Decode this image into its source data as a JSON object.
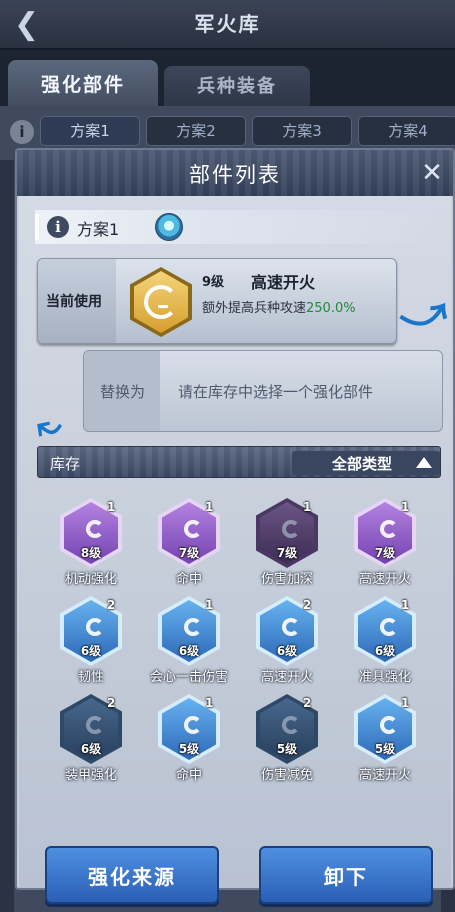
{
  "header": {
    "back_icon": "back-chevron-icon",
    "title": "军火库"
  },
  "tabs": [
    {
      "label": "强化部件",
      "active": true
    },
    {
      "label": "兵种装备",
      "active": false
    }
  ],
  "plans": {
    "info_icon": "i",
    "items": [
      {
        "label": "方案1",
        "active": true
      },
      {
        "label": "方案2",
        "active": false
      },
      {
        "label": "方案3",
        "active": false
      },
      {
        "label": "方案4",
        "active": false
      }
    ]
  },
  "modal": {
    "title": "部件列表",
    "close_icon": "✕",
    "plan": {
      "info_icon": "i",
      "name": "方案1"
    },
    "current": {
      "label": "当前使用",
      "level": "9级",
      "name": "高速开火",
      "desc_prefix": "额外提高兵种攻速",
      "desc_value": "250.0%"
    },
    "replace": {
      "label": "替换为",
      "hint": "请在库存中选择一个强化部件"
    },
    "inventory": {
      "label": "库存",
      "filter": "全部类型"
    },
    "items": [
      {
        "level": "8级",
        "count": "1",
        "name": "机动强化",
        "color": "purple"
      },
      {
        "level": "7级",
        "count": "1",
        "name": "命中",
        "color": "purple"
      },
      {
        "level": "7级",
        "count": "1",
        "name": "伤害加深",
        "color": "dark-purple"
      },
      {
        "level": "7级",
        "count": "1",
        "name": "高速开火",
        "color": "purple"
      },
      {
        "level": "6级",
        "count": "2",
        "name": "韧性",
        "color": "blue"
      },
      {
        "level": "6级",
        "count": "1",
        "name": "会心一击伤害",
        "color": "blue"
      },
      {
        "level": "6级",
        "count": "2",
        "name": "高速开火",
        "color": "blue"
      },
      {
        "level": "6级",
        "count": "1",
        "name": "准具强化",
        "color": "blue"
      },
      {
        "level": "6级",
        "count": "2",
        "name": "装甲强化",
        "color": "dark-blue"
      },
      {
        "level": "5级",
        "count": "1",
        "name": "命中",
        "color": "blue"
      },
      {
        "level": "5级",
        "count": "2",
        "name": "伤害减免",
        "color": "dark-blue"
      },
      {
        "level": "5级",
        "count": "1",
        "name": "高速开火",
        "color": "blue"
      }
    ],
    "buttons": {
      "source": "强化来源",
      "unload": "卸下"
    }
  }
}
